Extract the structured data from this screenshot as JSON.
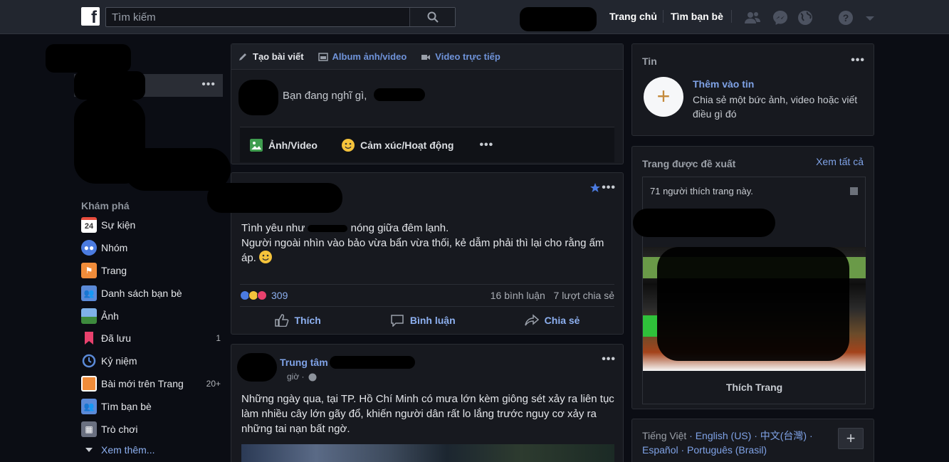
{
  "header": {
    "logo_letter": "f",
    "search_placeholder": "Tìm kiếm",
    "nav": {
      "home": "Trang chủ",
      "find_friends": "Tìm bạn bè"
    }
  },
  "sidebar": {
    "profile_more": "•••",
    "explore_title": "Khám phá",
    "items": [
      {
        "label": "Sự kiện",
        "icon": "calendar-icon",
        "badge": "24"
      },
      {
        "label": "Nhóm",
        "icon": "groups-icon"
      },
      {
        "label": "Trang",
        "icon": "flag-icon"
      },
      {
        "label": "Danh sách bạn bè",
        "icon": "friend-list-icon"
      },
      {
        "label": "Ảnh",
        "icon": "photo-icon"
      },
      {
        "label": "Đã lưu",
        "icon": "bookmark-icon",
        "count": "1"
      },
      {
        "label": "Kỷ niệm",
        "icon": "memories-icon"
      },
      {
        "label": "Bài mới trên Trang",
        "icon": "pages-feed-icon",
        "count": "20+"
      },
      {
        "label": "Tìm bạn bè",
        "icon": "find-friends-icon"
      },
      {
        "label": "Trò chơi",
        "icon": "games-icon"
      },
      {
        "label": "Xem thêm...",
        "icon": "chevron-down-icon"
      }
    ]
  },
  "composer": {
    "tabs": [
      "Tạo bài viết",
      "Album ảnh/video",
      "Video trực tiếp"
    ],
    "placeholder": "Bạn đang nghĩ gì,",
    "actions": [
      "Ảnh/Video",
      "Cảm xúc/Hoạt động"
    ],
    "more": "•••"
  },
  "post1": {
    "more": "•••",
    "text_line1": "Tình yêu như",
    "text_line1b": "nóng giữa đêm lạnh.",
    "text_line2": "Người ngoài nhìn vào bảo vừa bẩn vừa thối, kẻ dẫm phải thì lại cho rằng ấm áp.",
    "reactions_count": "309",
    "comments": "16 bình luận",
    "shares": "7 lượt chia sẻ",
    "actions": {
      "like": "Thích",
      "comment": "Bình luận",
      "share": "Chia sẻ"
    }
  },
  "post2": {
    "author": "Trung tâm",
    "time": "giờ ·",
    "more": "•••",
    "text": "Những ngày qua, tại TP. Hồ Chí Minh có mưa lớn kèm giông sét xảy ra liên tục làm nhiều cây lớn gãy đổ, khiến người dân rất lo lắng trước nguy cơ xảy ra những tai nạn bất ngờ."
  },
  "stories": {
    "title": "Tin",
    "more": "•••",
    "add_label": "Thêm vào tin",
    "add_desc": "Chia sẻ một bức ảnh, video hoặc viết điều gì đó",
    "plus": "+"
  },
  "suggested": {
    "title": "Trang được đề xuất",
    "see_all": "Xem tất cả",
    "likes_text": "71 người thích trang này.",
    "like_button": "Thích Trang"
  },
  "languages": {
    "current": "Tiếng Việt",
    "others": [
      "English (US)",
      "中文(台灣)",
      "Español",
      "Português (Brasil)"
    ],
    "plus": "+"
  },
  "colors": {
    "accent": "#7fa2e6",
    "background": "#0b0d14",
    "card": "#17191f",
    "topbar": "#22262f"
  }
}
